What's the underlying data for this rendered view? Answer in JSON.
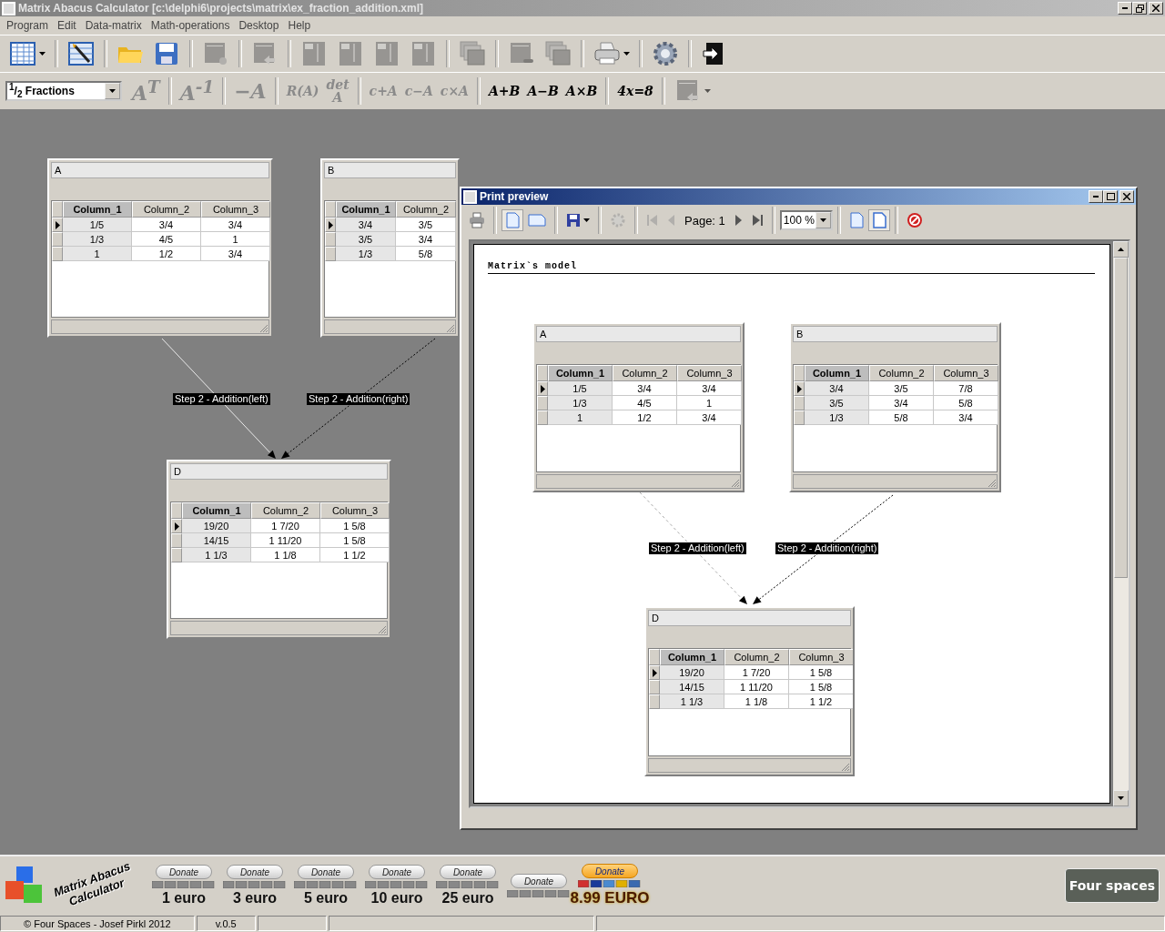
{
  "window": {
    "title": "Matrix Abacus Calculator [c:\\delphi6\\projects\\matrix\\ex_fraction_addition.xml]"
  },
  "menu": [
    "Program",
    "Edit",
    "Data-matrix",
    "Math-operations",
    "Desktop",
    "Help"
  ],
  "main_toolbar": [
    {
      "kind": "table",
      "disabled": false
    },
    {
      "kind": "table-wand",
      "disabled": false
    },
    {
      "kind": "folder",
      "disabled": false
    },
    {
      "kind": "save",
      "disabled": false
    },
    {
      "kind": "doc-gear",
      "disabled": true
    },
    {
      "kind": "doc-arrow",
      "disabled": true
    },
    {
      "kind": "layout",
      "disabled": true
    },
    {
      "kind": "layout",
      "disabled": true
    },
    {
      "kind": "layout",
      "disabled": true
    },
    {
      "kind": "layout",
      "disabled": true
    },
    {
      "kind": "windows",
      "disabled": true
    },
    {
      "kind": "doc-minus",
      "disabled": true
    },
    {
      "kind": "windows",
      "disabled": true
    },
    {
      "kind": "printer",
      "disabled": false
    },
    {
      "kind": "gear",
      "disabled": false
    },
    {
      "kind": "exit",
      "disabled": false
    }
  ],
  "operations_toolbar": {
    "format": {
      "symbol": "$^{1}$/$_{2}$",
      "value": "Fractions"
    },
    "buttons": [
      {
        "kind": "big",
        "label": "A$^{T}$",
        "disabled": true
      },
      {
        "kind": "big",
        "label": "A$^{-1}$",
        "disabled": true
      },
      {
        "kind": "big",
        "label": "−A",
        "disabled": true
      },
      {
        "kind": "small",
        "label": "R(A)",
        "disabled": true
      },
      {
        "kind": "stacked",
        "lines": [
          "det",
          "A"
        ],
        "disabled": true
      },
      {
        "kind": "small",
        "label": "c+A",
        "disabled": true
      },
      {
        "kind": "small",
        "label": "c−A",
        "disabled": true
      },
      {
        "kind": "small",
        "label": "c×A",
        "disabled": true
      },
      {
        "kind": "small",
        "label": "A+B",
        "disabled": false
      },
      {
        "kind": "small",
        "label": "A−B",
        "disabled": false
      },
      {
        "kind": "small",
        "label": "A×B",
        "disabled": false
      },
      {
        "kind": "small",
        "label": "4x=8",
        "disabled": false
      },
      {
        "kind": "icon",
        "disabled": true
      }
    ]
  },
  "desktop": {
    "matrices": [
      {
        "name": "A",
        "columns": [
          {
            "label": "Column_1",
            "selected": true
          },
          {
            "label": "Column_2",
            "selected": false
          },
          {
            "label": "Column_3",
            "selected": false
          }
        ],
        "rows": [
          {
            "selected": true,
            "cells": [
              "1/5",
              "3/4",
              "3/4"
            ]
          },
          {
            "selected": false,
            "cells": [
              "1/3",
              "4/5",
              "1"
            ]
          },
          {
            "selected": false,
            "cells": [
              "1",
              "1/2",
              "3/4"
            ]
          }
        ]
      },
      {
        "name": "B",
        "columns": [
          {
            "label": "Column_1",
            "selected": true
          },
          {
            "label": "Column_2",
            "selected": false
          }
        ],
        "rows": [
          {
            "selected": true,
            "cells": [
              "3/4",
              "3/5"
            ]
          },
          {
            "selected": false,
            "cells": [
              "3/5",
              "3/4"
            ]
          },
          {
            "selected": false,
            "cells": [
              "1/3",
              "5/8"
            ]
          }
        ]
      },
      {
        "name": "D",
        "columns": [
          {
            "label": "Column_1",
            "selected": true
          },
          {
            "label": "Column_2",
            "selected": false
          },
          {
            "label": "Column_3",
            "selected": false
          }
        ],
        "rows": [
          {
            "selected": true,
            "cells": [
              "19/20",
              "1 7/20",
              "1 5/8"
            ]
          },
          {
            "selected": false,
            "cells": [
              "14/15",
              "1 11/20",
              "1 5/8"
            ]
          },
          {
            "selected": false,
            "cells": [
              "1 1/3",
              "1 1/8",
              "1 1/2"
            ]
          }
        ]
      }
    ],
    "connections": [
      {
        "label": "Step 2 - Addition(left)"
      },
      {
        "label": "Step 2 - Addition(right)"
      }
    ]
  },
  "print_preview": {
    "title": "Print preview",
    "toolbar": [
      {
        "kind": "print",
        "pressed": false,
        "disabled": false
      },
      {
        "kind": "portrait",
        "pressed": true,
        "disabled": false
      },
      {
        "kind": "landscape",
        "pressed": false,
        "disabled": false
      },
      {
        "kind": "save",
        "pressed": false,
        "disabled": false
      },
      {
        "kind": "gear",
        "pressed": false,
        "disabled": true
      },
      {
        "kind": "first",
        "pressed": false,
        "disabled": true
      },
      {
        "kind": "prev",
        "pressed": false,
        "disabled": true
      },
      {
        "kind": "page-label",
        "text": "Page: 1"
      },
      {
        "kind": "next",
        "pressed": false,
        "disabled": false
      },
      {
        "kind": "last",
        "pressed": false,
        "disabled": false
      },
      {
        "kind": "zoom",
        "value": "100 %"
      },
      {
        "kind": "page-width",
        "pressed": false,
        "disabled": false
      },
      {
        "kind": "whole-page",
        "pressed": true,
        "disabled": false
      },
      {
        "kind": "close",
        "pressed": false,
        "disabled": false
      }
    ],
    "document": {
      "heading": "Matrix`s model",
      "matrices": [
        {
          "name": "A",
          "columns": [
            {
              "label": "Column_1",
              "selected": true
            },
            {
              "label": "Column_2",
              "selected": false
            },
            {
              "label": "Column_3",
              "selected": false
            }
          ],
          "rows": [
            {
              "selected": true,
              "cells": [
                "1/5",
                "3/4",
                "3/4"
              ]
            },
            {
              "selected": false,
              "cells": [
                "1/3",
                "4/5",
                "1"
              ]
            },
            {
              "selected": false,
              "cells": [
                "1",
                "1/2",
                "3/4"
              ]
            }
          ]
        },
        {
          "name": "B",
          "columns": [
            {
              "label": "Column_1",
              "selected": true
            },
            {
              "label": "Column_2",
              "selected": false
            },
            {
              "label": "Column_3",
              "selected": false
            }
          ],
          "rows": [
            {
              "selected": true,
              "cells": [
                "3/4",
                "3/5",
                "7/8"
              ]
            },
            {
              "selected": false,
              "cells": [
                "3/5",
                "3/4",
                "5/8"
              ]
            },
            {
              "selected": false,
              "cells": [
                "1/3",
                "5/8",
                "3/4"
              ]
            }
          ]
        },
        {
          "name": "D",
          "columns": [
            {
              "label": "Column_1",
              "selected": true
            },
            {
              "label": "Column_2",
              "selected": false
            },
            {
              "label": "Column_3",
              "selected": false
            }
          ],
          "rows": [
            {
              "selected": true,
              "cells": [
                "19/20",
                "1 7/20",
                "1 5/8"
              ]
            },
            {
              "selected": false,
              "cells": [
                "14/15",
                "1 11/20",
                "1 5/8"
              ]
            },
            {
              "selected": false,
              "cells": [
                "1 1/3",
                "1 1/8",
                "1 1/2"
              ]
            }
          ]
        }
      ],
      "connections": [
        {
          "label": "Step 2 - Addition(left)"
        },
        {
          "label": "Step 2 - Addition(right)"
        }
      ]
    }
  },
  "footer": {
    "logo_text": "Matrix Abacus Calculator",
    "donations": [
      {
        "button": "Donate",
        "amount": "1 euro",
        "highlighted": false
      },
      {
        "button": "Donate",
        "amount": "3 euro",
        "highlighted": false
      },
      {
        "button": "Donate",
        "amount": "5 euro",
        "highlighted": false
      },
      {
        "button": "Donate",
        "amount": "10 euro",
        "highlighted": false
      },
      {
        "button": "Donate",
        "amount": "25 euro",
        "highlighted": false
      },
      {
        "button": "Donate",
        "highlighted": false
      },
      {
        "button": "Donate",
        "amount": "8.99 EURO",
        "highlighted": true
      }
    ],
    "brand": "Four spaces"
  },
  "status_bar": [
    "© Four Spaces - Josef Pirkl 2012",
    "v.0.5"
  ]
}
